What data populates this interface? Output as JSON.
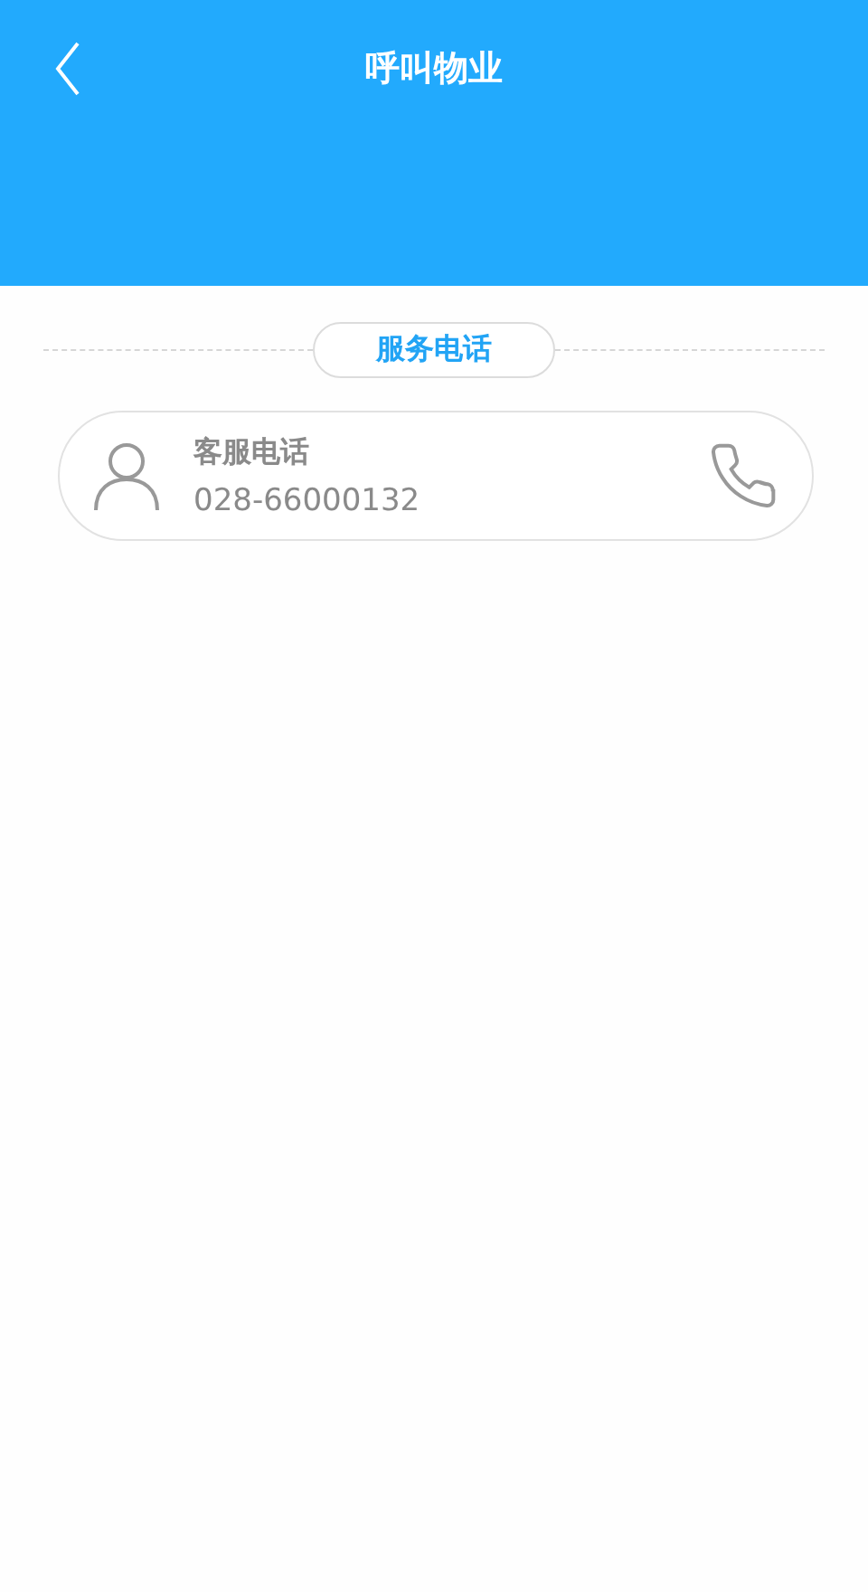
{
  "header": {
    "title": "呼叫物业"
  },
  "section": {
    "title": "服务电话"
  },
  "contacts": [
    {
      "name": "客服电话",
      "phone": "028-66000132"
    }
  ]
}
